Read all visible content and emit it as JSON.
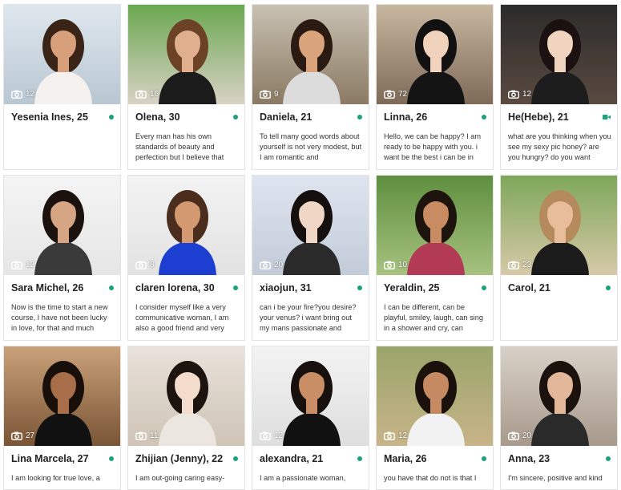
{
  "colors": {
    "online": "#1aa37a",
    "video": "#1aa37a",
    "text": "#222222",
    "border": "#e3e3e3"
  },
  "profiles": [
    {
      "name": "Yesenia Ines, 25",
      "photos": "12",
      "status": "online-dot",
      "desc": "",
      "bg": [
        "#dfe7ee",
        "#b9c7d2"
      ],
      "skin": "#d8a07a",
      "hair": "#3a2418",
      "top": "#f4f1ee"
    },
    {
      "name": "Olena, 30",
      "photos": "16",
      "status": "online-dot",
      "desc": "Every man has his own standards of beauty and perfection but I believe that",
      "bg": [
        "#6aa84f",
        "#d9d2c5"
      ],
      "skin": "#e0b08e",
      "hair": "#6b4226",
      "top": "#1b1b1b"
    },
    {
      "name": "Daniela, 21",
      "photos": "9",
      "status": "online-dot",
      "desc": "To tell many good words about yourself is not very modest, but I am romantic and",
      "bg": [
        "#c9c1b3",
        "#8a7a63"
      ],
      "skin": "#d9a37c",
      "hair": "#2a1a12",
      "top": "#dcdcdc"
    },
    {
      "name": "Linna, 26",
      "photos": "72",
      "status": "online-dot",
      "desc": "Hello, we can be happy? I am ready to be happy with you. i want be the best i can be in",
      "bg": [
        "#c8b7a0",
        "#7d6a58"
      ],
      "skin": "#f1d3bd",
      "hair": "#111111",
      "top": "#141414"
    },
    {
      "name": "He(Hebe), 21",
      "photos": "12",
      "status": "video-icon",
      "desc": "what are you thinking when you see my sexy pic honey? are you hungry? do you want",
      "bg": [
        "#2b2b2b",
        "#5a4a40"
      ],
      "skin": "#f0d4c0",
      "hair": "#1a1110",
      "top": "#1d1d1d"
    },
    {
      "name": "Sara Michel, 26",
      "photos": "12",
      "status": "online-dot",
      "desc": "Now is the time to start a new course, I have not been lucky in love, for that and much",
      "bg": [
        "#f4f4f4",
        "#e6e6e6"
      ],
      "skin": "#d6a583",
      "hair": "#1b120e",
      "top": "#3a3a3a"
    },
    {
      "name": "claren lorena, 30",
      "photos": "8",
      "status": "online-dot",
      "desc": "I consider myself like a very communicative woman, I am also a good friend and very",
      "bg": [
        "#f3f3f3",
        "#e2e2e2"
      ],
      "skin": "#d39a72",
      "hair": "#4a2d1c",
      "top": "#1d3fd1"
    },
    {
      "name": "xiaojun, 31",
      "photos": "20",
      "status": "online-dot",
      "desc": "can i be your fire?you desire? your venus? i want bring out my mans passionate and",
      "bg": [
        "#dfe5ef",
        "#c2cbd8"
      ],
      "skin": "#f0d6c4",
      "hair": "#15100e",
      "top": "#2a2a2a"
    },
    {
      "name": "Yeraldin, 25",
      "photos": "10",
      "status": "online-dot",
      "desc": "I can be different, can be playful, smiley, laugh, can sing in a shower and cry, can",
      "bg": [
        "#5e8f3f",
        "#a7c27f"
      ],
      "skin": "#c98b62",
      "hair": "#1e140e",
      "top": "#b23a54"
    },
    {
      "name": "Carol, 21",
      "photos": "23",
      "status": "online-dot",
      "desc": "",
      "bg": [
        "#7ea85a",
        "#d7c9a8"
      ],
      "skin": "#e7bd9c",
      "hair": "#b58a5c",
      "top": "#1b1b1b"
    },
    {
      "name": "Lina Marcela, 27",
      "photos": "27",
      "status": "online-dot",
      "desc": "I am looking for true love, a",
      "bg": [
        "#c9a27a",
        "#7a5535"
      ],
      "skin": "#a86e4a",
      "hair": "#180f0b",
      "top": "#111111"
    },
    {
      "name": "Zhijian (Jenny), 22",
      "photos": "11",
      "status": "online-dot",
      "desc": "I am out-going caring easy-",
      "bg": [
        "#e8e2da",
        "#cfc4b6"
      ],
      "skin": "#f3dccb",
      "hair": "#1d1410",
      "top": "#ece6e0"
    },
    {
      "name": "alexandra, 21",
      "photos": "12",
      "status": "online-dot",
      "desc": "I am a passionate woman,",
      "bg": [
        "#f3f3f3",
        "#dedede"
      ],
      "skin": "#c98e66",
      "hair": "#17100c",
      "top": "#111111"
    },
    {
      "name": "Maria, 26",
      "photos": "12",
      "status": "online-dot",
      "desc": "you have that do not is that I",
      "bg": [
        "#9aa56a",
        "#c8b48a"
      ],
      "skin": "#c58a62",
      "hair": "#1a110c",
      "top": "#f2f2f2"
    },
    {
      "name": "Anna, 23",
      "photos": "20",
      "status": "online-dot",
      "desc": "I'm sincere, positive and kind",
      "bg": [
        "#d9d1c8",
        "#a89a8c"
      ],
      "skin": "#e2b79a",
      "hair": "#1b120e",
      "top": "#2a2a2a"
    }
  ]
}
